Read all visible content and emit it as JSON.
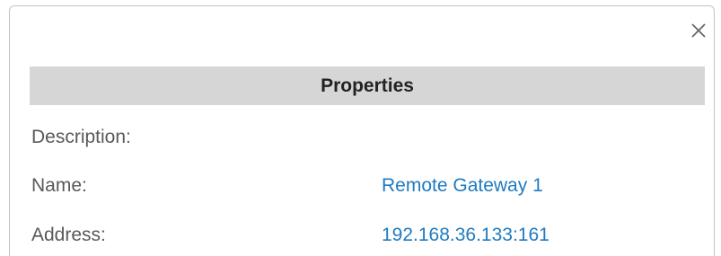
{
  "header": {
    "title": "Properties"
  },
  "close_icon": "close-icon",
  "colors": {
    "header_bg": "#d6d6d6",
    "label_text": "#595959",
    "value_text": "#1f7bc1"
  },
  "properties": [
    {
      "label": "Description:",
      "value": ""
    },
    {
      "label": "Name:",
      "value": "Remote Gateway 1"
    },
    {
      "label": "Address:",
      "value": "192.168.36.133:161"
    }
  ]
}
